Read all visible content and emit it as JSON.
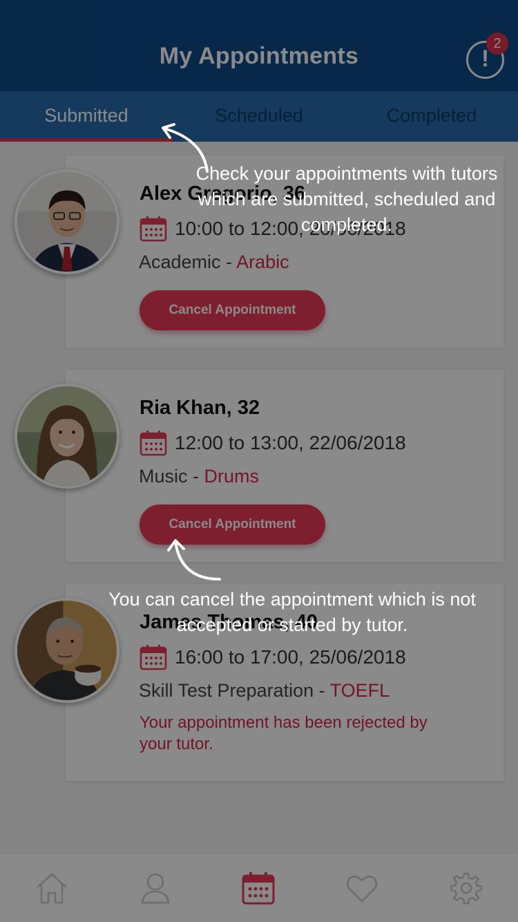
{
  "header": {
    "title": "My Appointments",
    "alert_icon": "exclamation-icon",
    "alert_glyph": "!",
    "notification_count": "2"
  },
  "tabs": [
    {
      "label": "Submitted",
      "active": true
    },
    {
      "label": "Scheduled",
      "active": false
    },
    {
      "label": "Completed",
      "active": false
    }
  ],
  "appointments": [
    {
      "name": "Alex Gregorio, 36",
      "time": "10:00 to 12:00, 20/06/2018",
      "category": "Academic",
      "separator": " - ",
      "topic": "Arabic",
      "action_label": "Cancel Appointment"
    },
    {
      "name": "Ria Khan, 32",
      "time": "12:00 to 13:00, 22/06/2018",
      "category": "Music",
      "separator": " - ",
      "topic": "Drums",
      "action_label": "Cancel Appointment"
    },
    {
      "name": "James Thomas, 40",
      "time": "16:00 to 17:00, 25/06/2018",
      "category": "Skill Test Preparation",
      "separator": " - ",
      "topic": "TOEFL",
      "status_message": "Your appointment has been rejected by your tutor."
    }
  ],
  "bottom_nav": [
    {
      "icon": "home-icon",
      "active": false
    },
    {
      "icon": "profile-icon",
      "active": false
    },
    {
      "icon": "calendar-icon",
      "active": true
    },
    {
      "icon": "heart-icon",
      "active": false
    },
    {
      "icon": "settings-icon",
      "active": false
    }
  ],
  "tutorial": {
    "tip_tabs": "Check your appointments with tutors which are submitted, scheduled and completed.",
    "tip_cancel": "You can cancel the appointment which is not accepted or started by tutor."
  },
  "colors": {
    "header": "#0e4a85",
    "tabs": "#2a6cae",
    "accent": "#e83a55",
    "topic_text": "#d6264a"
  }
}
